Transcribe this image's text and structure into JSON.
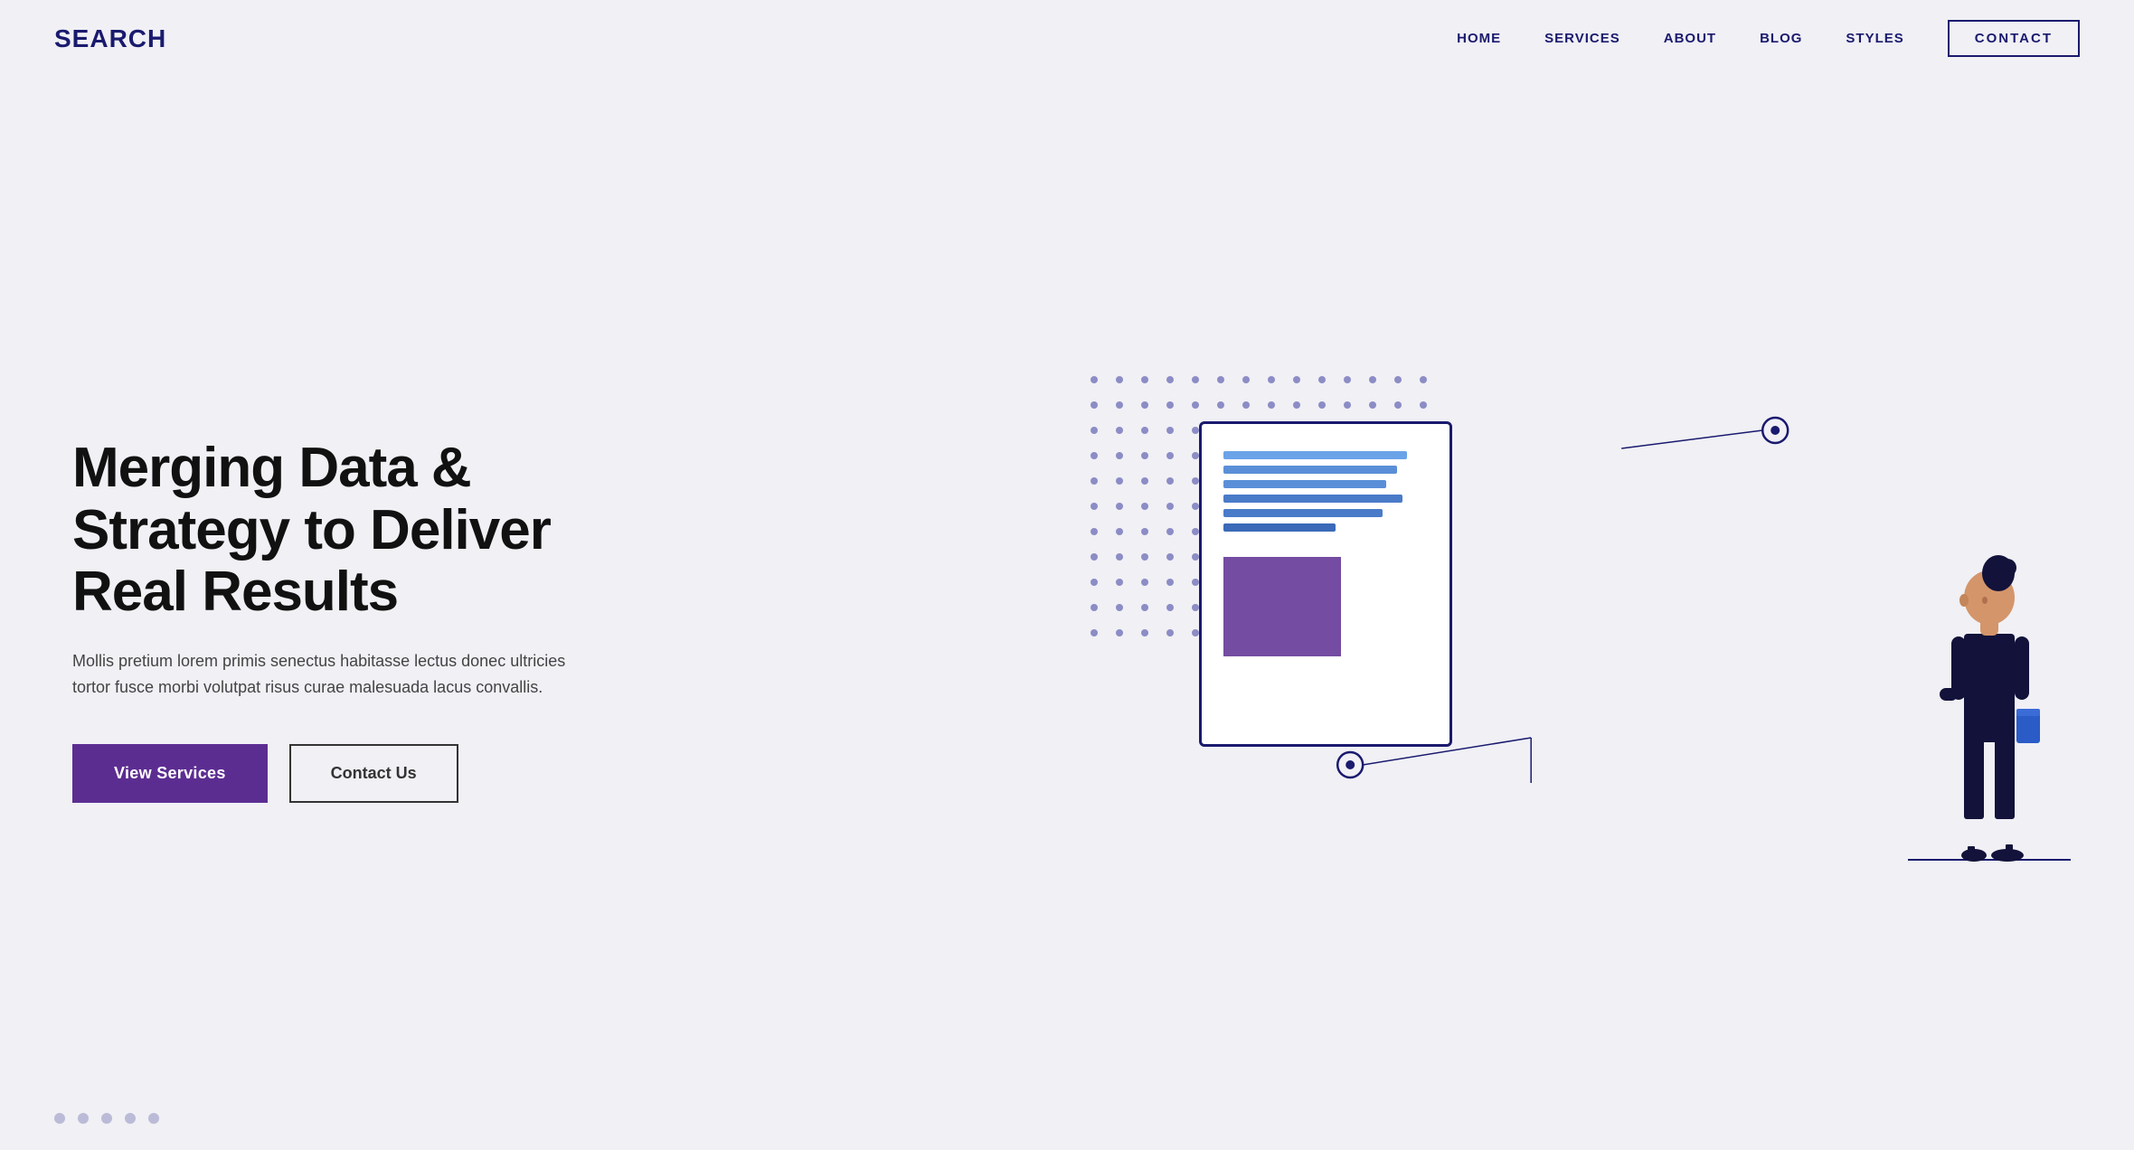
{
  "logo": "SEARCH",
  "nav": {
    "links": [
      {
        "label": "HOME",
        "id": "home"
      },
      {
        "label": "SERVICES",
        "id": "services"
      },
      {
        "label": "ABOUT",
        "id": "about"
      },
      {
        "label": "BLOG",
        "id": "blog"
      },
      {
        "label": "STYLES",
        "id": "styles"
      }
    ],
    "contact_label": "CONTACT"
  },
  "hero": {
    "title": "Merging Data & Strategy to Deliver Real Results",
    "subtitle": "Mollis pretium lorem primis senectus habitasse lectus donec ultricies tortor fusce morbi volutpat risus curae malesuada lacus convallis.",
    "btn_primary": "View Services",
    "btn_secondary": "Contact Us"
  },
  "pagination": {
    "dots": [
      false,
      false,
      false,
      false,
      false
    ]
  },
  "colors": {
    "brand_dark": "#1a1a6e",
    "brand_purple": "#5c2d91",
    "bg": "#f0f0f5",
    "dot_color": "#3a3a9e",
    "line_blue": "#5a8fd8"
  }
}
